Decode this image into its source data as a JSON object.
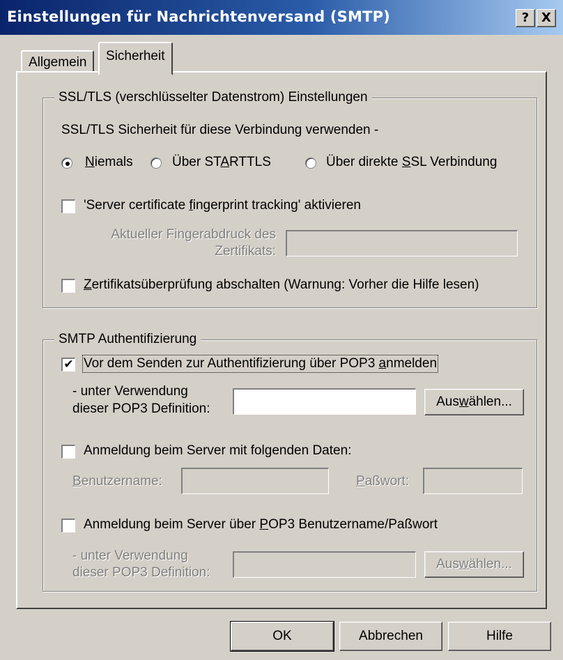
{
  "window": {
    "title": "Einstellungen für Nachrichtenversand (SMTP)",
    "help_button": "?",
    "close_button": "X"
  },
  "tabs": [
    {
      "label": "Allgemein",
      "active": false
    },
    {
      "label": "Sicherheit",
      "active": true
    }
  ],
  "ssl_group": {
    "title": "SSL/TLS (verschlüsselter Datenstrom) Einstellungen",
    "prompt": "SSL/TLS Sicherheit für diese Verbindung verwenden -",
    "options": [
      {
        "pre": "",
        "u": "N",
        "post": "iemals",
        "selected": true
      },
      {
        "pre": "Über ST",
        "u": "A",
        "post": "RTTLS",
        "selected": false
      },
      {
        "pre": "Über direkte ",
        "u": "S",
        "post": "SL Verbindung",
        "selected": false
      }
    ],
    "fingerprint_check": {
      "pre": "'Server certificate ",
      "u": "f",
      "post": "ingerprint tracking' aktivieren",
      "checked": false
    },
    "fingerprint_label_line1": "Aktueller Fingerabdruck des",
    "fingerprint_label_line2": "Zertifikats:",
    "fingerprint_value": "",
    "cert_check_off": {
      "pre": "",
      "u": "Z",
      "post": "ertifikatsüberprüfung abschalten (Warnung: Vorher die Hilfe lesen)",
      "checked": false
    }
  },
  "smtp_auth": {
    "title": "SMTP Authentifizierung",
    "pop3_before_send": {
      "pre": "Vor dem Senden zur Authentifizierung über POP3 ",
      "u": "a",
      "post": "nmelden",
      "checked": true
    },
    "pop3_def_label_line1": "- unter Verwendung",
    "pop3_def_label_line2": "dieser POP3 Definition:",
    "pop3_def_value": "",
    "select_button": {
      "pre": "Aus",
      "u": "w",
      "post": "ählen..."
    },
    "server_login": {
      "label": "Anmeldung beim Server mit folgenden Daten:",
      "checked": false
    },
    "username_label": {
      "pre": "",
      "u": "B",
      "post": "enutzername:"
    },
    "username_value": "",
    "password_label": {
      "pre": "",
      "u": "P",
      "post": "aßwort:"
    },
    "password_value": "",
    "pop3_login": {
      "pre": "Anmeldung beim Server über ",
      "u": "P",
      "post": "OP3 Benutzername/Paßwort",
      "checked": false
    },
    "pop3_def2_label_line1": "- unter Verwendung",
    "pop3_def2_label_line2": "dieser POP3 Definition:",
    "pop3_def2_value": "",
    "select_button2": {
      "pre": "Aus",
      "u": "w",
      "post": "ählen..."
    }
  },
  "footer": {
    "ok": "OK",
    "cancel": "Abbrechen",
    "help": "Hilfe"
  }
}
